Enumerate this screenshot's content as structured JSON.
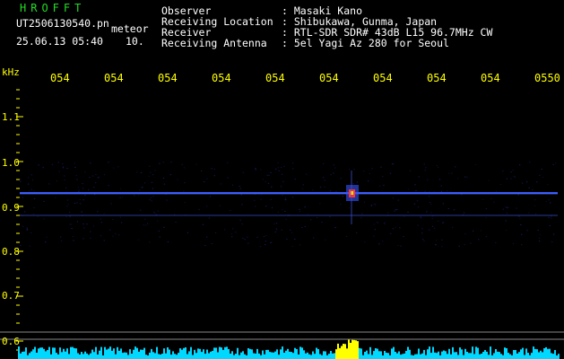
{
  "app_title": "HROFFT",
  "file": {
    "name": "UT2506130540.pn",
    "type": "meteor",
    "date_time": "25.06.13 05:40",
    "interval": "10."
  },
  "info": {
    "labels": [
      "Observer",
      "Receiving Location",
      "Receiver",
      "Receiving Antenna"
    ],
    "values": [
      ": Masaki Kano",
      ": Shibukawa, Gunma, Japan",
      ": RTL-SDR SDR# 43dB L15 96.7MHz CW",
      ": 5el Yagi Az 280 for Seoul"
    ]
  },
  "time_ticks": [
    "054",
    "054",
    "054",
    "054",
    "054",
    "054",
    "054",
    "054",
    "054",
    "0550"
  ],
  "freq_axis": {
    "unit": "kHz",
    "labels": [
      "1.1",
      "1.0",
      "0.9",
      "0.8",
      "0.7",
      "0.6"
    ]
  },
  "colors": {
    "background": "#000000",
    "text": "#ffffff",
    "title": "#22dd22",
    "axis": "#ffff00",
    "signal_line": "#3355ff",
    "meteor": "#ff3333",
    "spectrum": "#00d8ff",
    "spectrum_peak": "#ffff00"
  }
}
